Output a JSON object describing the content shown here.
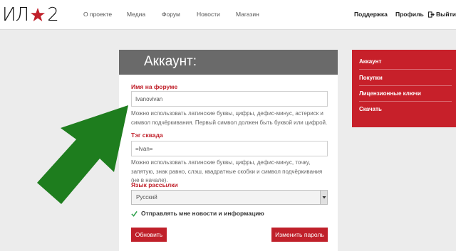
{
  "header": {
    "logo_text_left": "ИЛ",
    "logo_text_right": "2",
    "nav": [
      "О проекте",
      "Медиа",
      "Форум",
      "Новости",
      "Магазин"
    ],
    "support": "Поддержка",
    "profile": "Профиль",
    "exit": "Выйти"
  },
  "card": {
    "title": "Аккаунт:",
    "forum_name_label": "Имя на форуме",
    "forum_name_value": "Ivanovivan",
    "forum_name_hint": "Можно использовать латинские буквы, цифры, дефис-минус, астериск и символ подчёркивания. Первый символ должен быть буквой или цифрой.",
    "squad_tag_label": "Тэг сквада",
    "squad_tag_value": "=Ivan=",
    "squad_tag_hint": "Можно использовать латинские буквы, цифры, дефис-минус, точку, запятую, знак равно, слэш, квадратные скобки и символ подчёркивания (не в начале).",
    "mail_lang_label": "Язык рассылки",
    "mail_lang_value": "Русский",
    "newsletter_label": "Отправлять мне новости и информацию",
    "update_button": "Обновить",
    "change_password_button": "Изменить пароль"
  },
  "sidebar": {
    "items": [
      "Аккаунт",
      "Покупки",
      "Лицензионные ключи",
      "Скачать"
    ]
  },
  "colors": {
    "accent": "#c0202a",
    "arrow": "#1e7d1e",
    "header_band": "#6a6a6a"
  }
}
